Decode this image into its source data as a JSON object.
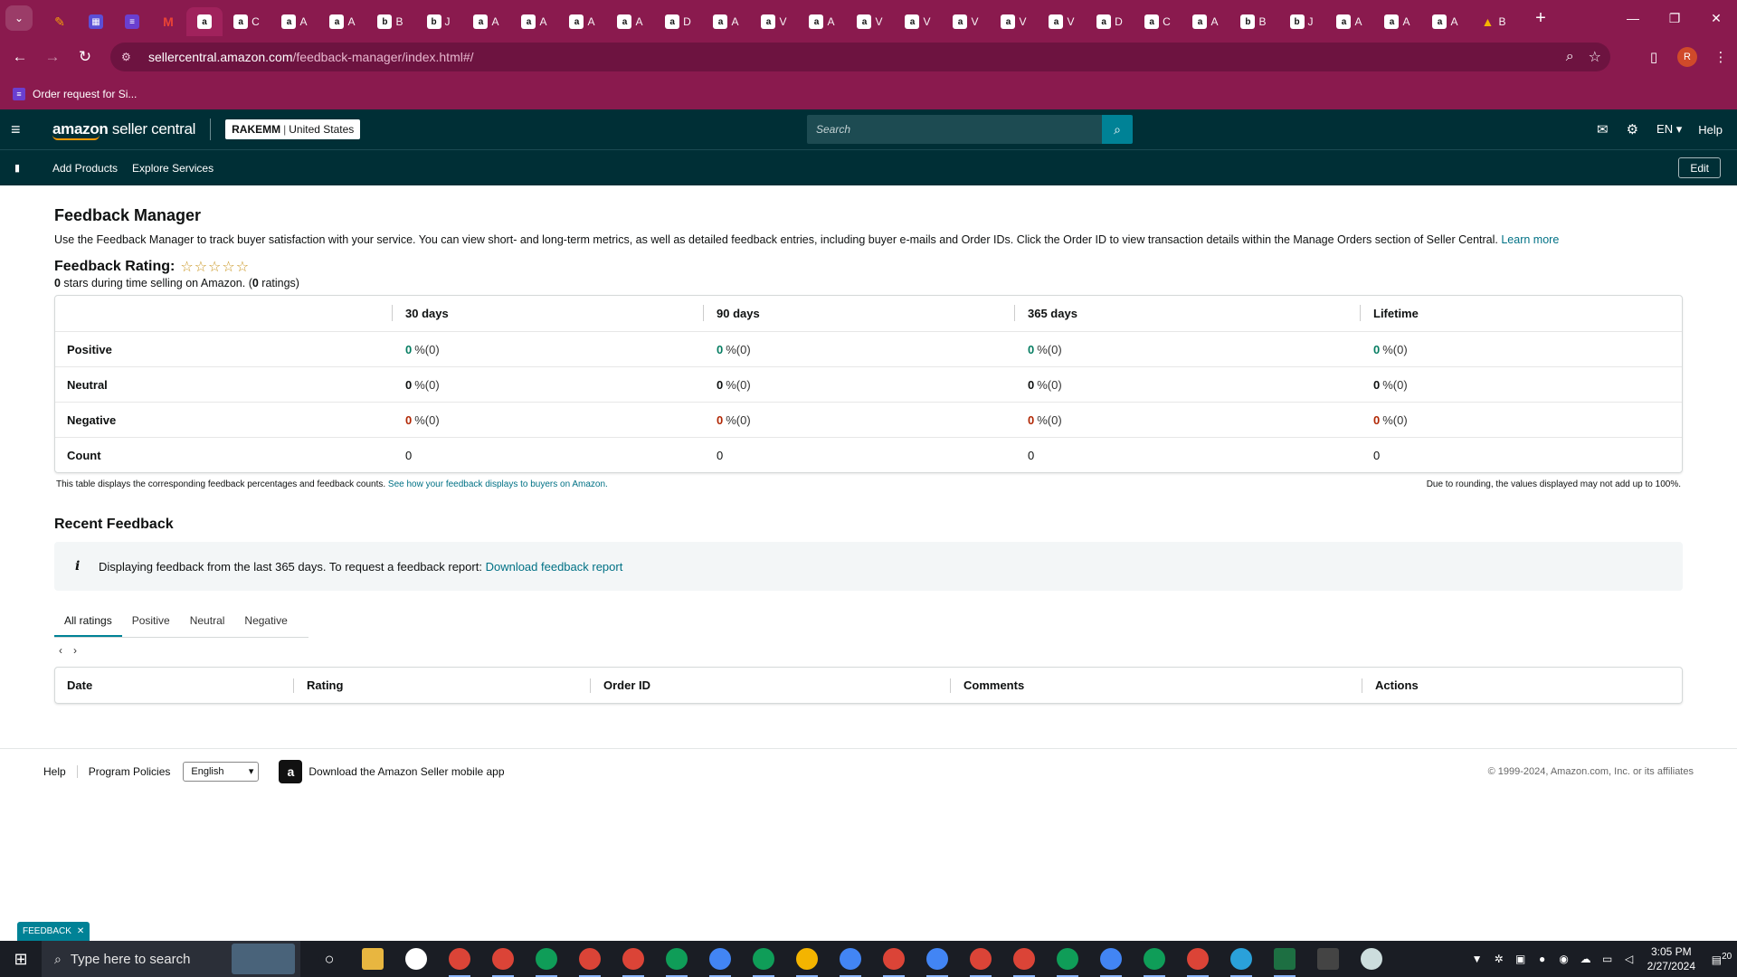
{
  "browser": {
    "tabs": [
      {
        "favicon": "chevron-down-icon",
        "label": ""
      },
      {
        "favicon": "app-icon",
        "label": ""
      },
      {
        "favicon": "calendar-icon",
        "label": ""
      },
      {
        "favicon": "tasks-icon",
        "label": ""
      },
      {
        "favicon": "gmail-icon",
        "label": ""
      },
      {
        "favicon": "amazon-icon",
        "label": ""
      },
      {
        "favicon": "amazon-icon",
        "label": "C"
      },
      {
        "favicon": "amazon-icon",
        "label": "A"
      },
      {
        "favicon": "amazon-icon",
        "label": "A"
      },
      {
        "favicon": "b-icon",
        "label": "B"
      },
      {
        "favicon": "b-icon",
        "label": "J"
      },
      {
        "favicon": "amazon-icon",
        "label": "A"
      },
      {
        "favicon": "amazon-icon",
        "label": "A"
      },
      {
        "favicon": "amazon-icon",
        "label": "A"
      },
      {
        "favicon": "amazon-icon",
        "label": "A"
      },
      {
        "favicon": "amazon-icon",
        "label": "D"
      },
      {
        "favicon": "amazon-icon",
        "label": "A"
      },
      {
        "favicon": "amazon-icon",
        "label": "V"
      },
      {
        "favicon": "amazon-icon",
        "label": "A"
      },
      {
        "favicon": "amazon-icon",
        "label": "V"
      },
      {
        "favicon": "amazon-icon",
        "label": "V"
      },
      {
        "favicon": "amazon-icon",
        "label": "V"
      },
      {
        "favicon": "amazon-icon",
        "label": "V"
      },
      {
        "favicon": "amazon-icon",
        "label": "V"
      },
      {
        "favicon": "amazon-icon",
        "label": "D"
      },
      {
        "favicon": "amazon-icon",
        "label": "C"
      },
      {
        "favicon": "amazon-icon",
        "label": "A"
      },
      {
        "favicon": "b-icon",
        "label": "B"
      },
      {
        "favicon": "b-icon",
        "label": "J"
      },
      {
        "favicon": "amazon-icon",
        "label": "A"
      },
      {
        "favicon": "amazon-icon",
        "label": "A"
      },
      {
        "favicon": "amazon-icon",
        "label": "A"
      },
      {
        "favicon": "drive-icon",
        "label": "B"
      }
    ],
    "url_host": "sellercentral.amazon.com",
    "url_path": "/feedback-manager/index.html#/",
    "profile_initial": "R",
    "bookmark": "Order request for Si..."
  },
  "header": {
    "logo_text_bold": "amazon",
    "logo_text": " seller central",
    "account_name": "RAKEMM",
    "account_sep": "|",
    "marketplace": "United States",
    "search_placeholder": "Search",
    "language": "EN",
    "help": "Help"
  },
  "subnav": {
    "links": [
      "Add Products",
      "Explore Services"
    ],
    "edit": "Edit"
  },
  "page": {
    "title": "Feedback Manager",
    "description": "Use the Feedback Manager to track buyer satisfaction with your service. You can view short- and long-term metrics, as well as detailed feedback entries, including buyer e-mails and Order IDs. Click the Order ID to view transaction details within the Manage Orders section of Seller Central.",
    "learn_more": "Learn more",
    "rating_label": "Feedback Rating:",
    "stars": "☆☆☆☆☆",
    "rating_value": "0",
    "rating_text": " stars during time selling on Amazon. (",
    "rating_count": "0",
    "rating_count_text": " ratings)"
  },
  "feedback_table": {
    "headers": [
      "",
      "30 days",
      "90 days",
      "365 days",
      "Lifetime"
    ],
    "rows": [
      {
        "label": "Positive",
        "values": [
          "0",
          "0",
          "0",
          "0"
        ],
        "suffix": "%(0)",
        "color": "#067d62"
      },
      {
        "label": "Neutral",
        "values": [
          "0",
          "0",
          "0",
          "0"
        ],
        "suffix": "%(0)",
        "color": "#0f1111"
      },
      {
        "label": "Negative",
        "values": [
          "0",
          "0",
          "0",
          "0"
        ],
        "suffix": "%(0)",
        "color": "#b12704"
      }
    ],
    "count_row": {
      "label": "Count",
      "values": [
        "0",
        "0",
        "0",
        "0"
      ]
    },
    "note_left": "This table displays the corresponding feedback percentages and feedback counts.",
    "note_link": "See how your feedback displays to buyers on Amazon.",
    "note_right": "Due to rounding, the values displayed may not add up to 100%."
  },
  "recent": {
    "title": "Recent Feedback",
    "info_text": "Displaying feedback from the last 365 days. To request a feedback report:",
    "info_link": "Download feedback report",
    "tabs": [
      "All ratings",
      "Positive",
      "Neutral",
      "Negative"
    ],
    "active_tab": "All ratings",
    "columns": [
      "Date",
      "Rating",
      "Order ID",
      "Comments",
      "Actions"
    ]
  },
  "footer": {
    "links": [
      "Help",
      "Program Policies"
    ],
    "language_select": "English",
    "app_text": "Download the Amazon Seller mobile app",
    "copyright": "© 1999-2024, Amazon.com, Inc. or its affiliates"
  },
  "feedback_button": "FEEDBACK",
  "taskbar": {
    "search_placeholder": "Type here to search",
    "time": "3:05 PM",
    "date": "2/27/2024",
    "notification_count": "20"
  }
}
